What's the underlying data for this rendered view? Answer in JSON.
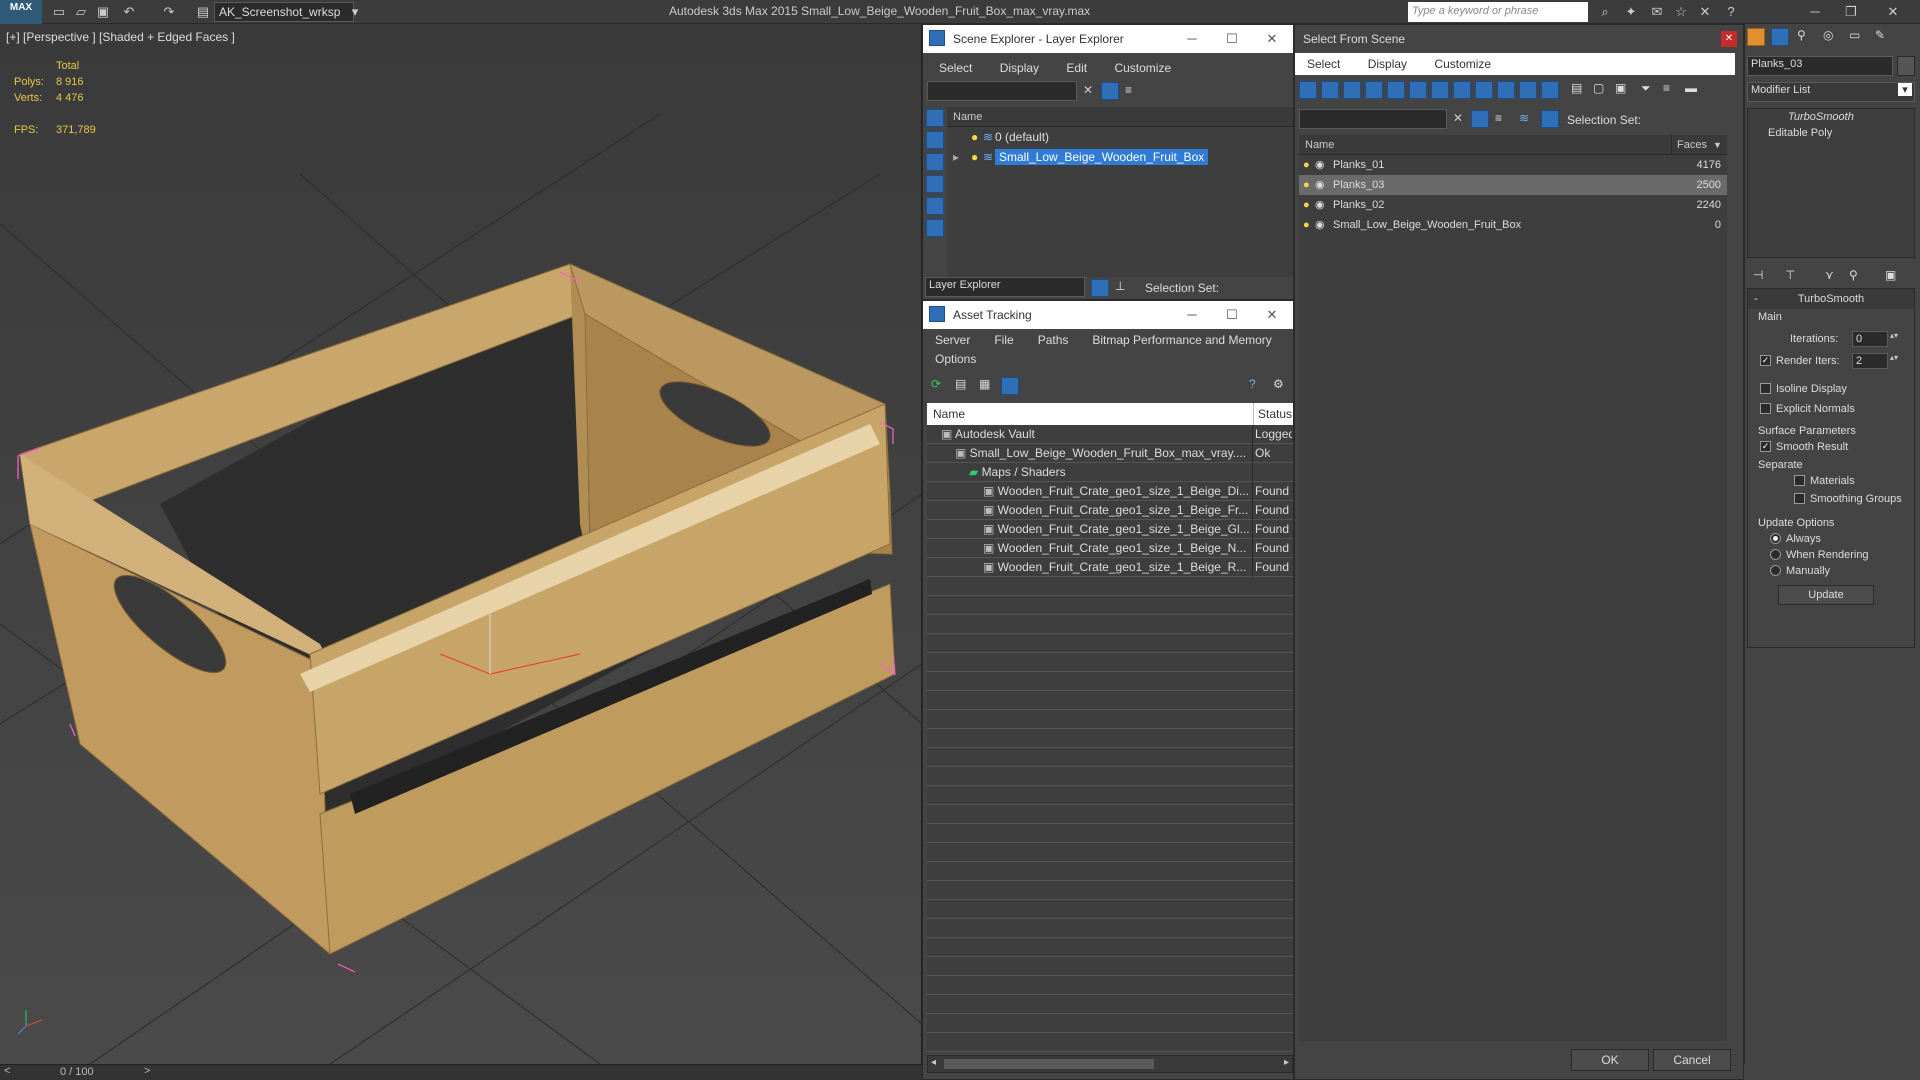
{
  "app": {
    "title": "Autodesk 3ds Max  2015    Small_Low_Beige_Wooden_Fruit_Box_max_vray.max",
    "logo": "MAX",
    "workspace": "AK_Screenshot_wrksp",
    "search_placeholder": "Type a keyword or phrase"
  },
  "viewport": {
    "label": "[+] [Perspective ] [Shaded + Edged Faces ]",
    "stats_total": "Total",
    "polys_label": "Polys:",
    "polys_value": "8 916",
    "verts_label": "Verts:",
    "verts_value": "4 476",
    "fps_label": "FPS:",
    "fps_value": "371,789",
    "frame": "0 / 100"
  },
  "scene_explorer": {
    "title": "Scene Explorer - Layer Explorer",
    "menu": [
      "Select",
      "Display",
      "Edit",
      "Customize"
    ],
    "col_name": "Name",
    "rows": [
      "0 (default)",
      "Small_Low_Beige_Wooden_Fruit_Box"
    ],
    "footer_dropdown": "Layer Explorer",
    "footer_selset": "Selection Set:"
  },
  "asset_tracking": {
    "title": "Asset Tracking",
    "menu": [
      "Server",
      "File",
      "Paths",
      "Bitmap Performance and Memory",
      "Options"
    ],
    "col_name": "Name",
    "col_status": "Status",
    "rows": [
      {
        "name": "Autodesk Vault",
        "status": "Logged",
        "indent": 0
      },
      {
        "name": "Small_Low_Beige_Wooden_Fruit_Box_max_vray....",
        "status": "Ok",
        "indent": 1
      },
      {
        "name": "Maps / Shaders",
        "status": "",
        "indent": 2
      },
      {
        "name": "Wooden_Fruit_Crate_geo1_size_1_Beige_Di...",
        "status": "Found",
        "indent": 3
      },
      {
        "name": "Wooden_Fruit_Crate_geo1_size_1_Beige_Fr...",
        "status": "Found",
        "indent": 3
      },
      {
        "name": "Wooden_Fruit_Crate_geo1_size_1_Beige_Gl...",
        "status": "Found",
        "indent": 3
      },
      {
        "name": "Wooden_Fruit_Crate_geo1_size_1_Beige_N...",
        "status": "Found",
        "indent": 3
      },
      {
        "name": "Wooden_Fruit_Crate_geo1_size_1_Beige_R...",
        "status": "Found",
        "indent": 3
      }
    ]
  },
  "select_from_scene": {
    "title": "Select From Scene",
    "menu": [
      "Select",
      "Display",
      "Customize"
    ],
    "selset": "Selection Set:",
    "col_name": "Name",
    "col_faces": "Faces",
    "rows": [
      {
        "name": "Planks_01",
        "faces": "4176",
        "selected": false
      },
      {
        "name": "Planks_03",
        "faces": "2500",
        "selected": true
      },
      {
        "name": "Planks_02",
        "faces": "2240",
        "selected": false
      },
      {
        "name": "Small_Low_Beige_Wooden_Fruit_Box",
        "faces": "0",
        "selected": false
      }
    ],
    "ok": "OK",
    "cancel": "Cancel"
  },
  "command_panel": {
    "object_name": "Planks_03",
    "modifier_list": "Modifier List",
    "stack": [
      "TurboSmooth",
      "Editable Poly"
    ],
    "rollout_title": "TurboSmooth",
    "main_label": "Main",
    "iterations_label": "Iterations:",
    "iterations_value": "0",
    "render_iters_label": "Render Iters:",
    "render_iters_value": "2",
    "isoline": "Isoline Display",
    "explicit_normals": "Explicit Normals",
    "surface_params": "Surface Parameters",
    "smooth_result": "Smooth Result",
    "separate": "Separate",
    "materials": "Materials",
    "smoothing_groups": "Smoothing Groups",
    "update_options": "Update Options",
    "always": "Always",
    "when_rendering": "When Rendering",
    "manually": "Manually",
    "update": "Update"
  },
  "colors": {
    "selection_blue": "#2f7bd6",
    "stats_yellow": "#e8c84a",
    "wood": "#c9a66b",
    "bbox_pink": "#ff5fd2"
  }
}
